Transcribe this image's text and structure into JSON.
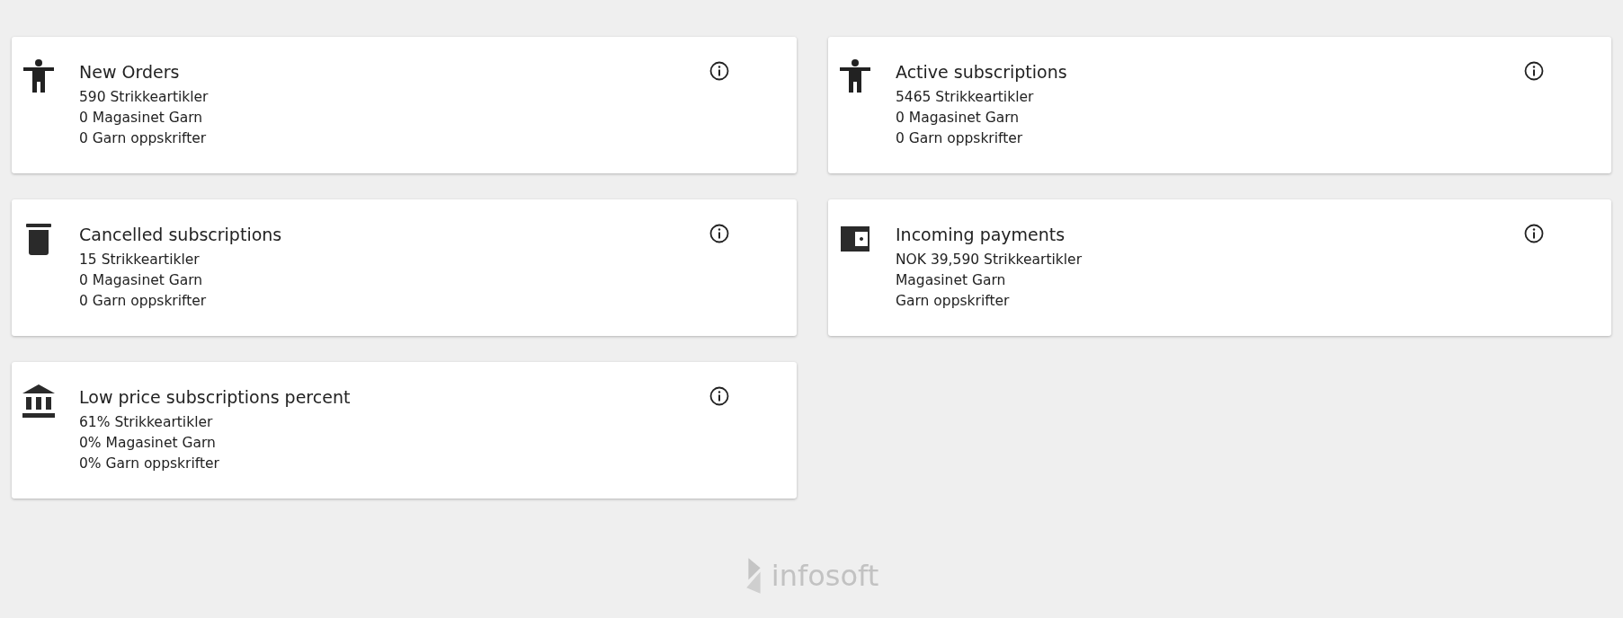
{
  "cards": [
    {
      "kind": "person",
      "title": "New Orders",
      "lines": [
        "590 Strikkeartikler",
        "0 Magasinet Garn",
        "0 Garn oppskrifter"
      ]
    },
    {
      "kind": "person",
      "title": "Active subscriptions",
      "lines": [
        "5465 Strikkeartikler",
        "0 Magasinet Garn",
        "0 Garn oppskrifter"
      ]
    },
    {
      "kind": "trash",
      "title": "Cancelled subscriptions",
      "lines": [
        "15 Strikkeartikler",
        "0 Magasinet Garn",
        "0 Garn oppskrifter"
      ]
    },
    {
      "kind": "wallet",
      "title": "Incoming payments",
      "lines": [
        "NOK 39,590 Strikkeartikler",
        "Magasinet Garn",
        "Garn oppskrifter"
      ]
    },
    {
      "kind": "bank",
      "title": "Low price subscriptions percent",
      "lines": [
        "61% Strikkeartikler",
        "0% Magasinet Garn",
        "0% Garn oppskrifter"
      ]
    }
  ],
  "footer": {
    "logo_text": "infosoft"
  }
}
